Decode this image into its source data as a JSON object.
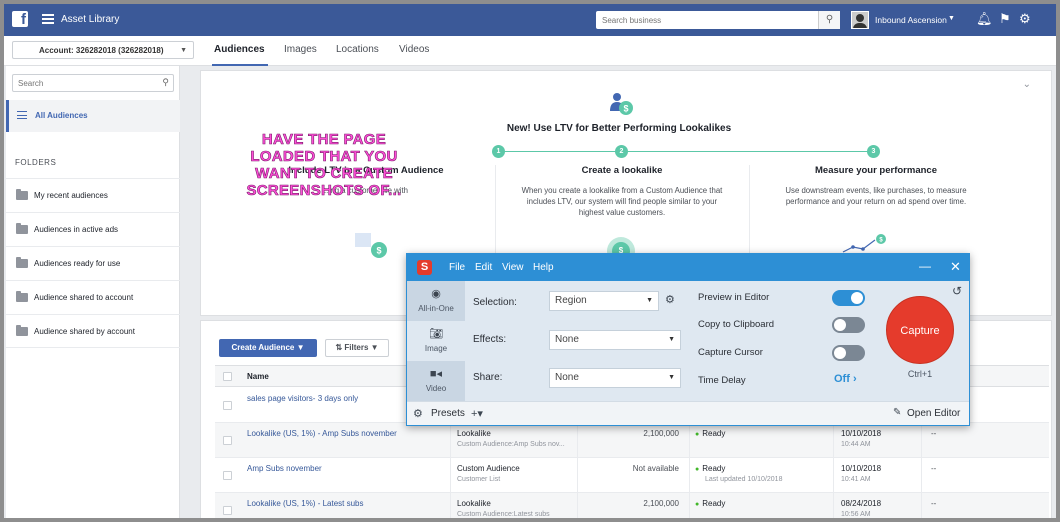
{
  "topbar": {
    "app_title": "Asset Library",
    "search_placeholder": "Search business",
    "user_name": "Inbound Ascension"
  },
  "account_bar": {
    "account_label": "Account: 326282018 (326282018)",
    "tabs": [
      "Audiences",
      "Images",
      "Locations",
      "Videos"
    ]
  },
  "sidebar": {
    "search_placeholder": "Search",
    "all_label": "All Audiences",
    "folders_heading": "FOLDERS",
    "folders": [
      "My recent audiences",
      "Audiences in active ads",
      "Audiences ready for use",
      "Audience shared to account",
      "Audience shared by account"
    ]
  },
  "promo": {
    "title": "New! Use LTV for Better Performing Lookalikes",
    "steps": [
      {
        "num": "1",
        "title": "Include LTV in a Custom Audience",
        "desc": "...ng a customer file with"
      },
      {
        "num": "2",
        "title": "Create a lookalike",
        "desc": "When you create a lookalike from a Custom Audience that includes LTV, our system will find people similar to your highest value customers."
      },
      {
        "num": "3",
        "title": "Measure your performance",
        "desc": "Use downstream events, like purchases, to measure performance and your return on ad spend over time."
      }
    ],
    "overlay": "HAVE THE PAGE LOADED THAT YOU WANT TO CREATE SCREENSHOTS OF..."
  },
  "table": {
    "create_button": "Create Audience",
    "filters_button": "Filters",
    "name_header": "Name",
    "rows": [
      {
        "name": "sales page visitors- 3 days only",
        "type": "",
        "type_sub": "",
        "size": "",
        "avail": "",
        "avail_sub": "",
        "date": "",
        "time": "",
        "extra": ""
      },
      {
        "name": "Lookalike (US, 1%) - Amp Subs november",
        "type": "Lookalike",
        "type_sub": "Custom Audience:Amp Subs nov...",
        "size": "2,100,000",
        "avail": "Ready",
        "avail_sub": "",
        "date": "10/10/2018",
        "time": "10:44 AM",
        "extra": "--"
      },
      {
        "name": "Amp Subs november",
        "type": "Custom Audience",
        "type_sub": "Customer List",
        "size": "Not available",
        "avail": "Ready",
        "avail_sub": "Last updated 10/10/2018",
        "date": "10/10/2018",
        "time": "10:41 AM",
        "extra": "--"
      },
      {
        "name": "Lookalike (US, 1%) - Latest subs",
        "type": "Lookalike",
        "type_sub": "Custom Audience:Latest subs",
        "size": "2,100,000",
        "avail": "Ready",
        "avail_sub": "",
        "date": "08/24/2018",
        "time": "10:56 AM",
        "extra": "--"
      }
    ]
  },
  "capture": {
    "menu": [
      "File",
      "Edit",
      "View",
      "Help"
    ],
    "modes": [
      "All-in-One",
      "Image",
      "Video"
    ],
    "selection_label": "Selection:",
    "selection_value": "Region",
    "effects_label": "Effects:",
    "effects_value": "None",
    "share_label": "Share:",
    "share_value": "None",
    "preview_label": "Preview in Editor",
    "clipboard_label": "Copy to Clipboard",
    "cursor_label": "Capture Cursor",
    "delay_label": "Time Delay",
    "delay_value": "Off",
    "capture_button": "Capture",
    "shortcut": "Ctrl+1",
    "presets": "Presets",
    "open_editor": "Open Editor",
    "toggles": {
      "preview": true,
      "clipboard": false,
      "cursor": false
    }
  },
  "colors": {
    "fb_blue": "#3b5998",
    "snag_blue": "#2d8fd5",
    "capture_red": "#e53b2c",
    "overlay_pink": "#ff4fd8"
  }
}
